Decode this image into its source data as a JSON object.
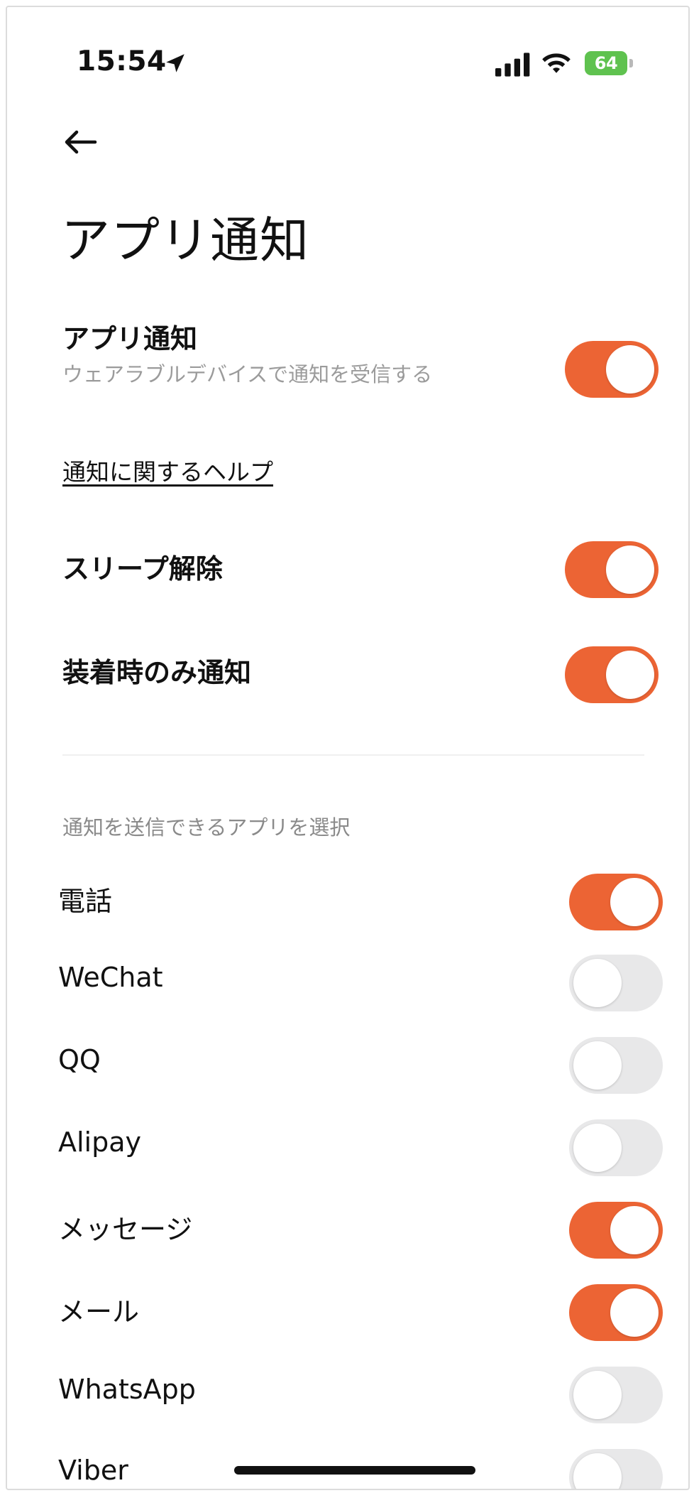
{
  "status_bar": {
    "time": "15:54",
    "battery": "64",
    "battery_color": "#5fc24f"
  },
  "header": {
    "back_icon": "back-arrow-icon",
    "title": "アプリ通知"
  },
  "master": {
    "title": "アプリ通知",
    "subtitle": "ウェアラブルデバイスで通知を受信する",
    "enabled": true
  },
  "help_link": "通知に関するヘルプ",
  "options": [
    {
      "label": "スリープ解除",
      "enabled": true
    },
    {
      "label": "装着時のみ通知",
      "enabled": true
    }
  ],
  "apps_section_label": "通知を送信できるアプリを選択",
  "apps": [
    {
      "label": "電話",
      "enabled": true
    },
    {
      "label": "WeChat",
      "enabled": false
    },
    {
      "label": "QQ",
      "enabled": false
    },
    {
      "label": "Alipay",
      "enabled": false
    },
    {
      "label": "メッセージ",
      "enabled": true
    },
    {
      "label": "メール",
      "enabled": true
    },
    {
      "label": "WhatsApp",
      "enabled": false
    },
    {
      "label": "Viber",
      "enabled": false
    }
  ],
  "colors": {
    "accent": "#ec6434",
    "toggle_off": "#e8e8e9"
  }
}
